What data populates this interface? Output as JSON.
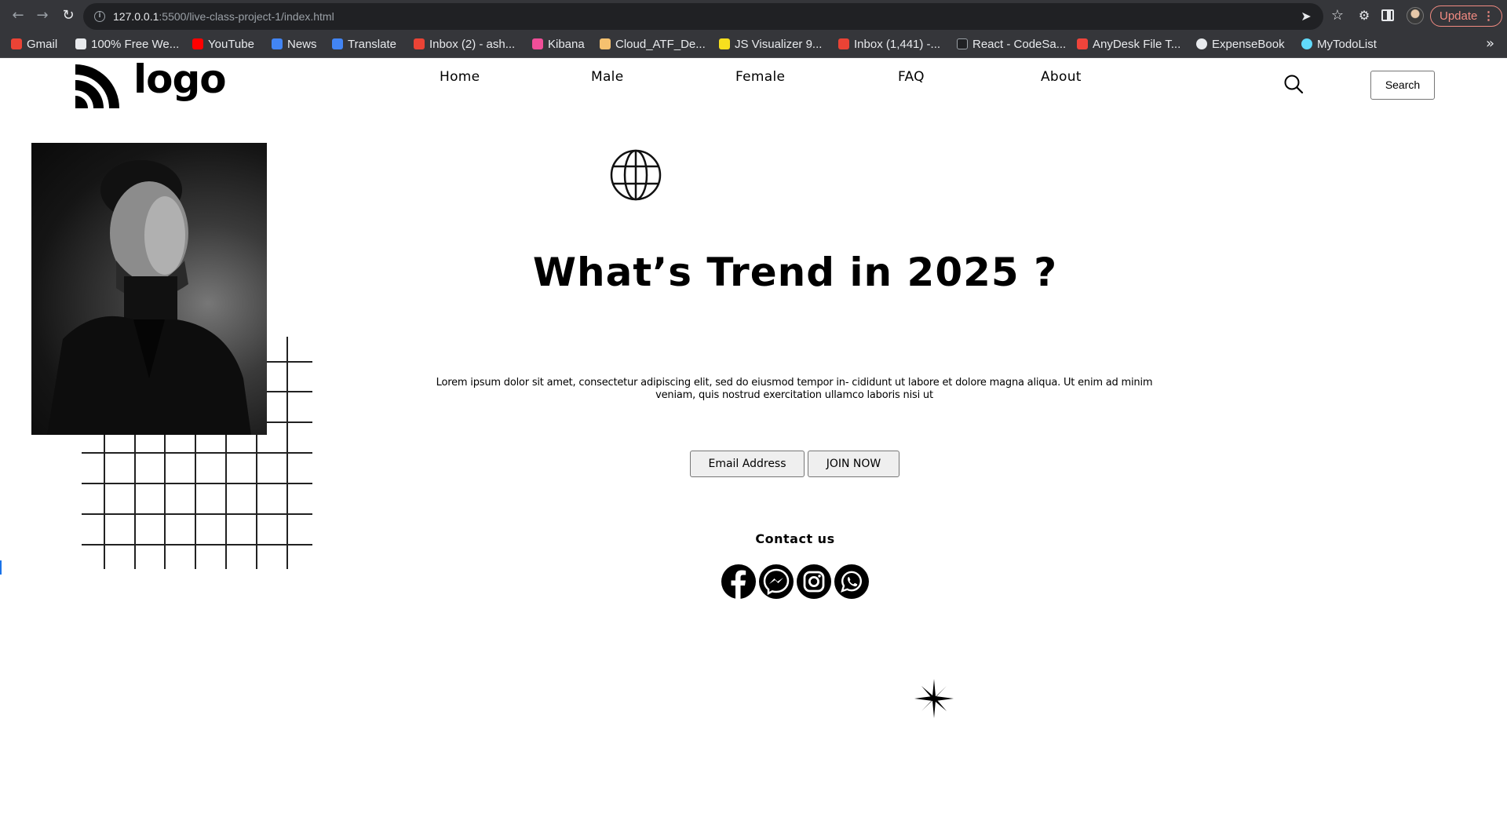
{
  "browser": {
    "url_host": "127.0.0.1",
    "url_rest": ":5500/live-class-project-1/index.html",
    "update_label": "Update",
    "bookmarks": [
      {
        "label": "Gmail",
        "color": "#ea4335"
      },
      {
        "label": "100% Free We...",
        "color": "#e8eaed"
      },
      {
        "label": "YouTube",
        "color": "#ff0000"
      },
      {
        "label": "News",
        "color": "#4285f4"
      },
      {
        "label": "Translate",
        "color": "#4285f4"
      },
      {
        "label": "Inbox (2) - ash...",
        "color": "#ea4335"
      },
      {
        "label": "Kibana",
        "color": "#f04e98"
      },
      {
        "label": "Cloud_ATF_De...",
        "color": "#f6c16f"
      },
      {
        "label": "JS Visualizer 9...",
        "color": "#f7df1e"
      },
      {
        "label": "Inbox (1,441) -...",
        "color": "#ea4335"
      },
      {
        "label": "React - CodeSa...",
        "color": "#202124"
      },
      {
        "label": "AnyDesk File T...",
        "color": "#ef443b"
      },
      {
        "label": "ExpenseBook",
        "color": "#e8eaed"
      },
      {
        "label": "MyTodoList",
        "color": "#61dafb"
      }
    ],
    "more_label": "»"
  },
  "header": {
    "logo_text": "logo",
    "nav": [
      "Home",
      "Male",
      "Female",
      "FAQ",
      "About"
    ],
    "search_button": "Search"
  },
  "hero": {
    "title": "What’s Trend in 2025 ?",
    "body": "Lorem ipsum dolor sit amet, consectetur adipiscing elit, sed do eiusmod tempor in- cididunt ut labore et dolore magna aliqua. Ut enim ad minim veniam, quis nostrud exercitation ullamco laboris nisi ut",
    "email_button": "Email Address",
    "join_button": "JOIN NOW"
  },
  "contact": {
    "heading": "Contact us",
    "icons": [
      "facebook-icon",
      "messenger-icon",
      "instagram-icon",
      "whatsapp-icon"
    ]
  },
  "colors": {
    "chrome": "#35363a",
    "omnibox": "#202124",
    "update": "#f28b82",
    "page_text": "#000000"
  }
}
